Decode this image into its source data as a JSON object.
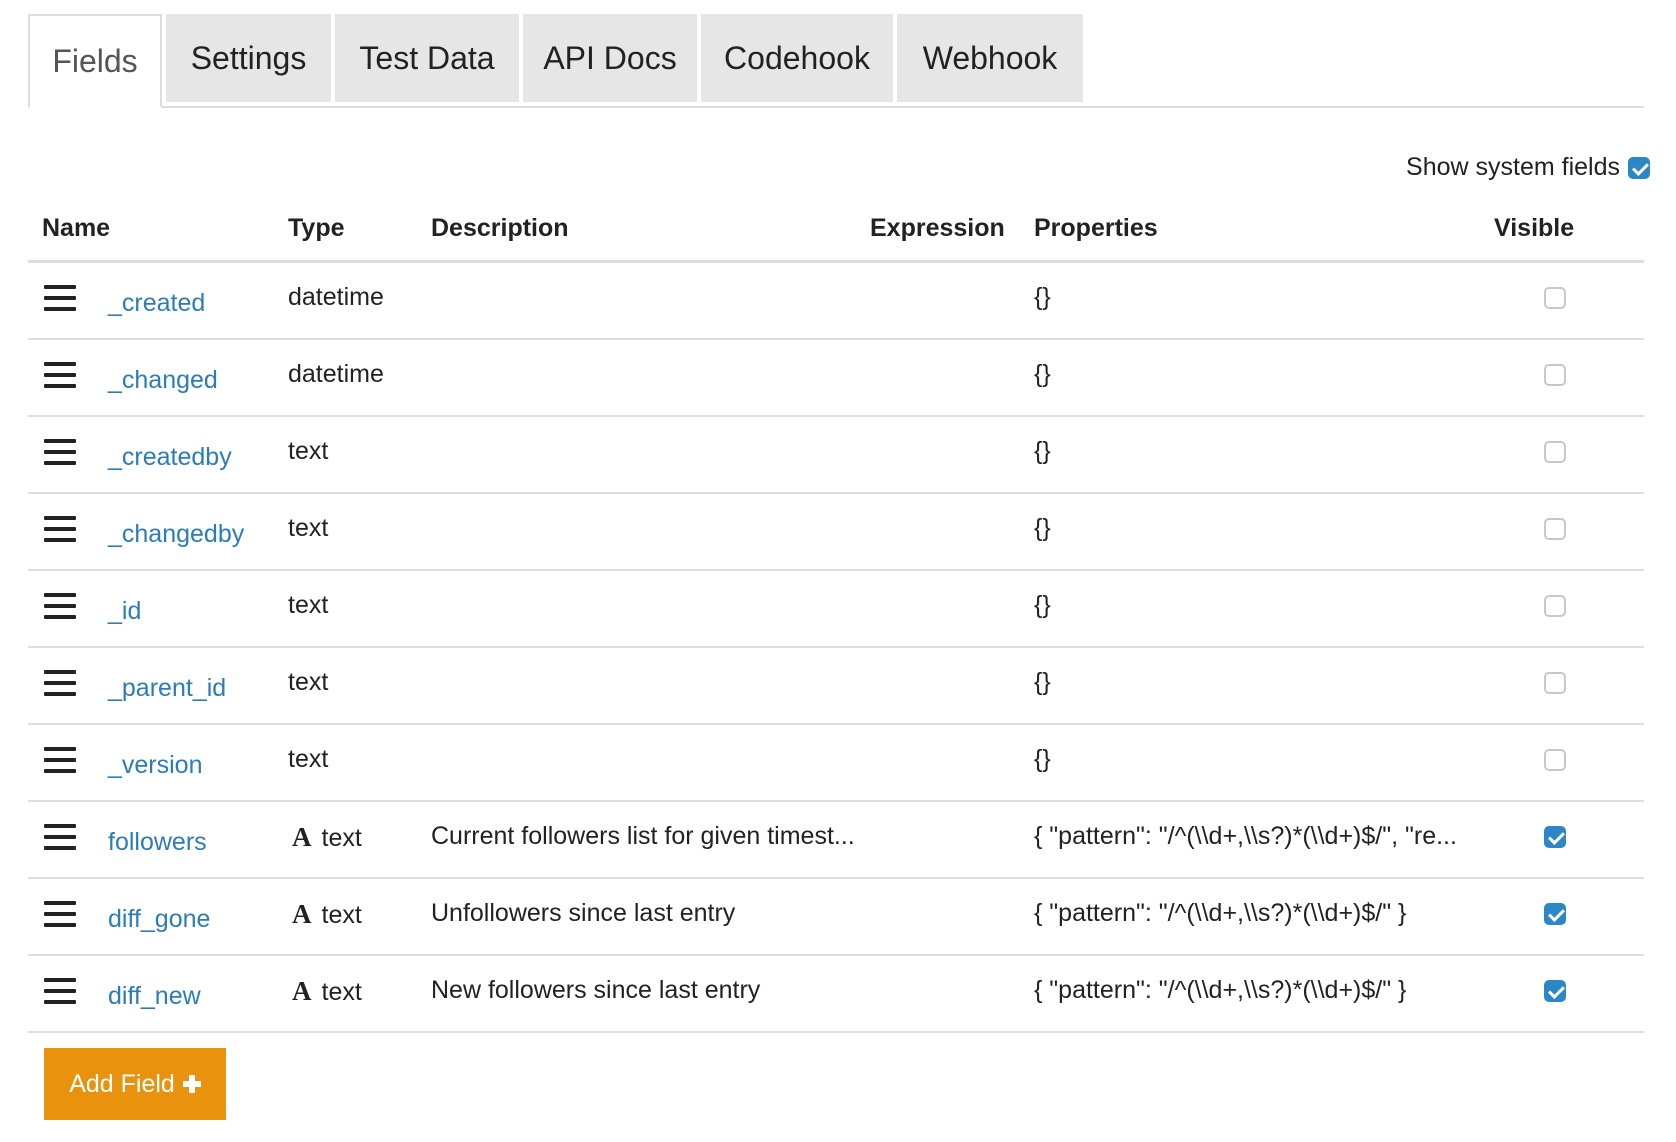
{
  "tabs": [
    {
      "label": "Fields",
      "active": true
    },
    {
      "label": "Settings",
      "active": false
    },
    {
      "label": "Test Data",
      "active": false
    },
    {
      "label": "API Docs",
      "active": false
    },
    {
      "label": "Codehook",
      "active": false
    },
    {
      "label": "Webhook",
      "active": false
    }
  ],
  "system_fields": {
    "label": "Show system fields",
    "checked": true
  },
  "table": {
    "headers": {
      "name": "Name",
      "type": "Type",
      "description": "Description",
      "expression": "Expression",
      "properties": "Properties",
      "visible": "Visible"
    },
    "rows": [
      {
        "name": "_created",
        "type": "datetime",
        "type_icon": "",
        "description": "",
        "expression": "",
        "properties": "{}",
        "visible": false
      },
      {
        "name": "_changed",
        "type": "datetime",
        "type_icon": "",
        "description": "",
        "expression": "",
        "properties": "{}",
        "visible": false
      },
      {
        "name": "_createdby",
        "type": "text",
        "type_icon": "",
        "description": "",
        "expression": "",
        "properties": "{}",
        "visible": false
      },
      {
        "name": "_changedby",
        "type": "text",
        "type_icon": "",
        "description": "",
        "expression": "",
        "properties": "{}",
        "visible": false
      },
      {
        "name": "_id",
        "type": "text",
        "type_icon": "",
        "description": "",
        "expression": "",
        "properties": "{}",
        "visible": false
      },
      {
        "name": "_parent_id",
        "type": "text",
        "type_icon": "",
        "description": "",
        "expression": "",
        "properties": "{}",
        "visible": false
      },
      {
        "name": "_version",
        "type": "text",
        "type_icon": "",
        "description": "",
        "expression": "",
        "properties": "{}",
        "visible": false
      },
      {
        "name": "followers",
        "type": "text",
        "type_icon": "A",
        "description": "Current followers list for given timest...",
        "expression": "",
        "properties": "{ \"pattern\": \"/^(\\\\d+,\\\\s?)*(\\\\d+)$/\", \"re...",
        "visible": true
      },
      {
        "name": "diff_gone",
        "type": "text",
        "type_icon": "A",
        "description": "Unfollowers since last entry",
        "expression": "",
        "properties": "{ \"pattern\": \"/^(\\\\d+,\\\\s?)*(\\\\d+)$/\" }",
        "visible": true
      },
      {
        "name": "diff_new",
        "type": "text",
        "type_icon": "A",
        "description": "New followers since last entry",
        "expression": "",
        "properties": "{ \"pattern\": \"/^(\\\\d+,\\\\s?)*(\\\\d+)$/\" }",
        "visible": true
      }
    ]
  },
  "add_button": {
    "label": "Add Field"
  },
  "colors": {
    "link": "#2b7cb8",
    "checkbox_checked": "#2b87c5",
    "button": "#e8920d",
    "tab_inactive": "#e6e6e6",
    "border": "#dddddd"
  },
  "icons": {
    "drag": "drag-handle-icon",
    "type_text": "text-type-icon",
    "plus": "plus-icon"
  }
}
